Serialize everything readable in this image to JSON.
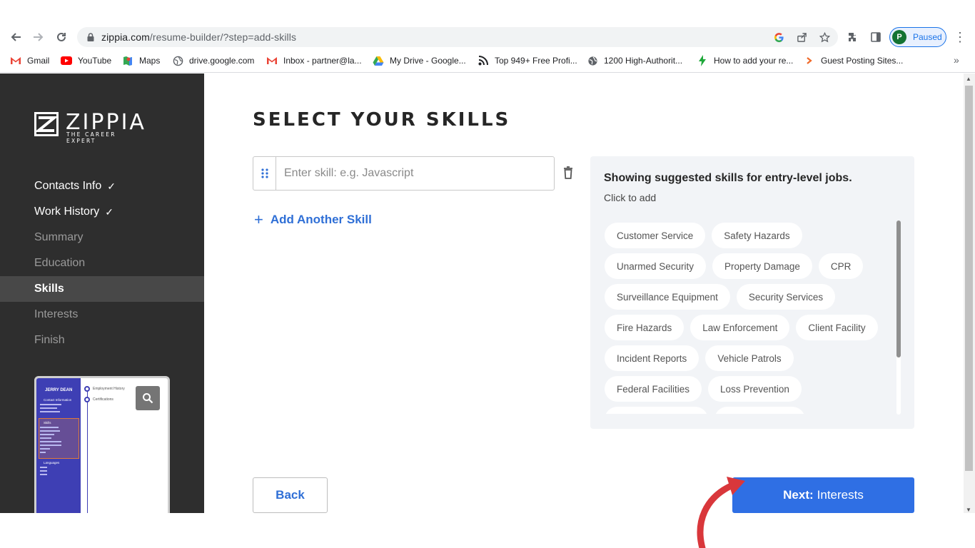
{
  "browser": {
    "url_host": "zippia.com",
    "url_path": "/resume-builder/?step=add-skills",
    "profile_initial": "P",
    "profile_status": "Paused",
    "bookmarks": [
      {
        "label": "Gmail",
        "icon": "gmail-icon"
      },
      {
        "label": "YouTube",
        "icon": "youtube-icon"
      },
      {
        "label": "Maps",
        "icon": "maps-icon"
      },
      {
        "label": "drive.google.com",
        "icon": "globe-icon"
      },
      {
        "label": "Inbox - partner@la...",
        "icon": "gmail-icon"
      },
      {
        "label": "My Drive - Google...",
        "icon": "drive-icon"
      },
      {
        "label": "Top 949+ Free Profi...",
        "icon": "rss-icon"
      },
      {
        "label": "1200 High-Authorit...",
        "icon": "globe-icon"
      },
      {
        "label": "How to add your re...",
        "icon": "bolt-icon"
      },
      {
        "label": "Guest Posting Sites...",
        "icon": "arrow-icon"
      }
    ],
    "more_bookmarks": "»"
  },
  "sidebar": {
    "logo_text": "ZIPPIA",
    "logo_tagline": "THE CAREER EXPERT",
    "steps": [
      {
        "label": "Contacts Info",
        "state": "done"
      },
      {
        "label": "Work History",
        "state": "done"
      },
      {
        "label": "Summary",
        "state": "todo"
      },
      {
        "label": "Education",
        "state": "todo"
      },
      {
        "label": "Skills",
        "state": "active"
      },
      {
        "label": "Interests",
        "state": "todo"
      },
      {
        "label": "Finish",
        "state": "todo"
      }
    ],
    "check_glyph": "✓",
    "preview": {
      "name": "JERRY DEAN",
      "section_contact": "Contact Information",
      "section_skills": "Skills",
      "section_languages": "Languages",
      "right_items": [
        "Employment History",
        "Certifications"
      ]
    }
  },
  "main": {
    "title": "SELECT YOUR SKILLS",
    "skill_input": {
      "value": "",
      "placeholder": "Enter skill: e.g. Javascript"
    },
    "add_skill_label": "Add Another Skill",
    "suggest_heading": "Showing suggested skills for entry-level jobs.",
    "suggest_sub": "Click to add",
    "chip_rows": [
      [
        "Customer Service",
        "Safety Hazards"
      ],
      [
        "Unarmed Security",
        "Property Damage",
        "CPR"
      ],
      [
        "Surveillance Equipment",
        "Security Services"
      ],
      [
        "Fire Hazards",
        "Law Enforcement",
        "Client Facility"
      ],
      [
        "Incident Reports",
        "Vehicle Patrols"
      ],
      [
        "Federal Facilities",
        "Loss Prevention"
      ]
    ],
    "back_label": "Back",
    "next_prefix": "Next:",
    "next_label": "Interests"
  },
  "colors": {
    "accent": "#2f6fe4",
    "sidebar_bg": "#2e2e2e",
    "annotation_arrow": "#d9373b"
  }
}
